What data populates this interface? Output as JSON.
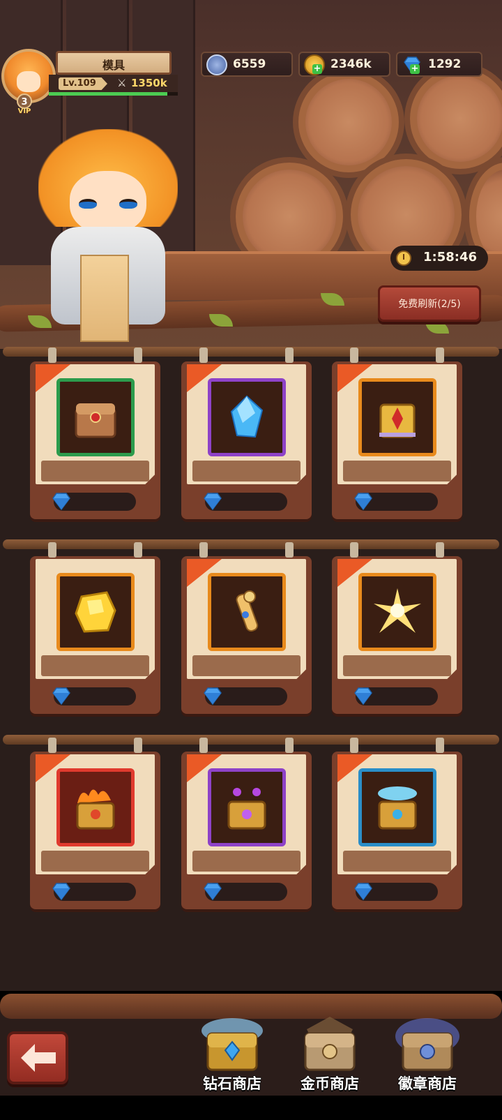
{
  "player": {
    "name": "模具",
    "level": "Lv.109",
    "power": "1350k",
    "vip_level": "3",
    "vip_label": "VIP",
    "xp_fraction": 0.92
  },
  "resources": [
    {
      "name": "badge",
      "icon": "sword-badge-icon",
      "value": "6559"
    },
    {
      "name": "gold",
      "icon": "gold-coin-icon",
      "value": "2346k"
    },
    {
      "name": "diamond",
      "icon": "diamond-icon",
      "value": "1292"
    }
  ],
  "shop": {
    "timer": "1:58:46",
    "refresh_label": "免费刷新(2/5)",
    "items": [
      {
        "name": "bronze-chest",
        "frame_color": "#2c9b4c",
        "art": "chest-icon",
        "has_corner": true
      },
      {
        "name": "blue-crystal",
        "frame_color": "#8e42c8",
        "art": "crystal-icon",
        "has_corner": true
      },
      {
        "name": "golden-relic-chest",
        "frame_color": "#e88a1c",
        "art": "relic-icon",
        "has_corner": true
      },
      {
        "name": "gold-ore",
        "frame_color": "#e88a1c",
        "art": "gold-ore-icon",
        "has_corner": false
      },
      {
        "name": "magic-scroll",
        "frame_color": "#e88a1c",
        "art": "scroll-icon",
        "has_corner": true
      },
      {
        "name": "light-burst",
        "frame_color": "#e88a1c",
        "art": "light-burst-icon",
        "has_corner": true
      },
      {
        "name": "fire-chest",
        "frame_color": "#e03a2e",
        "art": "fire-chest-icon",
        "has_corner": true
      },
      {
        "name": "purple-chest",
        "frame_color": "#8e42c8",
        "art": "purple-chest-icon",
        "has_corner": true
      },
      {
        "name": "blue-chest",
        "frame_color": "#2a8ec8",
        "art": "blue-chest-icon",
        "has_corner": true
      }
    ]
  },
  "nav": {
    "tabs": [
      {
        "label": "钻石商店",
        "icon": "diamond-chest-icon"
      },
      {
        "label": "金币商店",
        "icon": "gold-chest-icon"
      },
      {
        "label": "徽章商店",
        "icon": "badge-chest-icon"
      }
    ]
  },
  "colors": {
    "accent_orange": "#ea5a26",
    "gem_blue": "#4aa0f0",
    "gold_text": "#ffd76a"
  }
}
